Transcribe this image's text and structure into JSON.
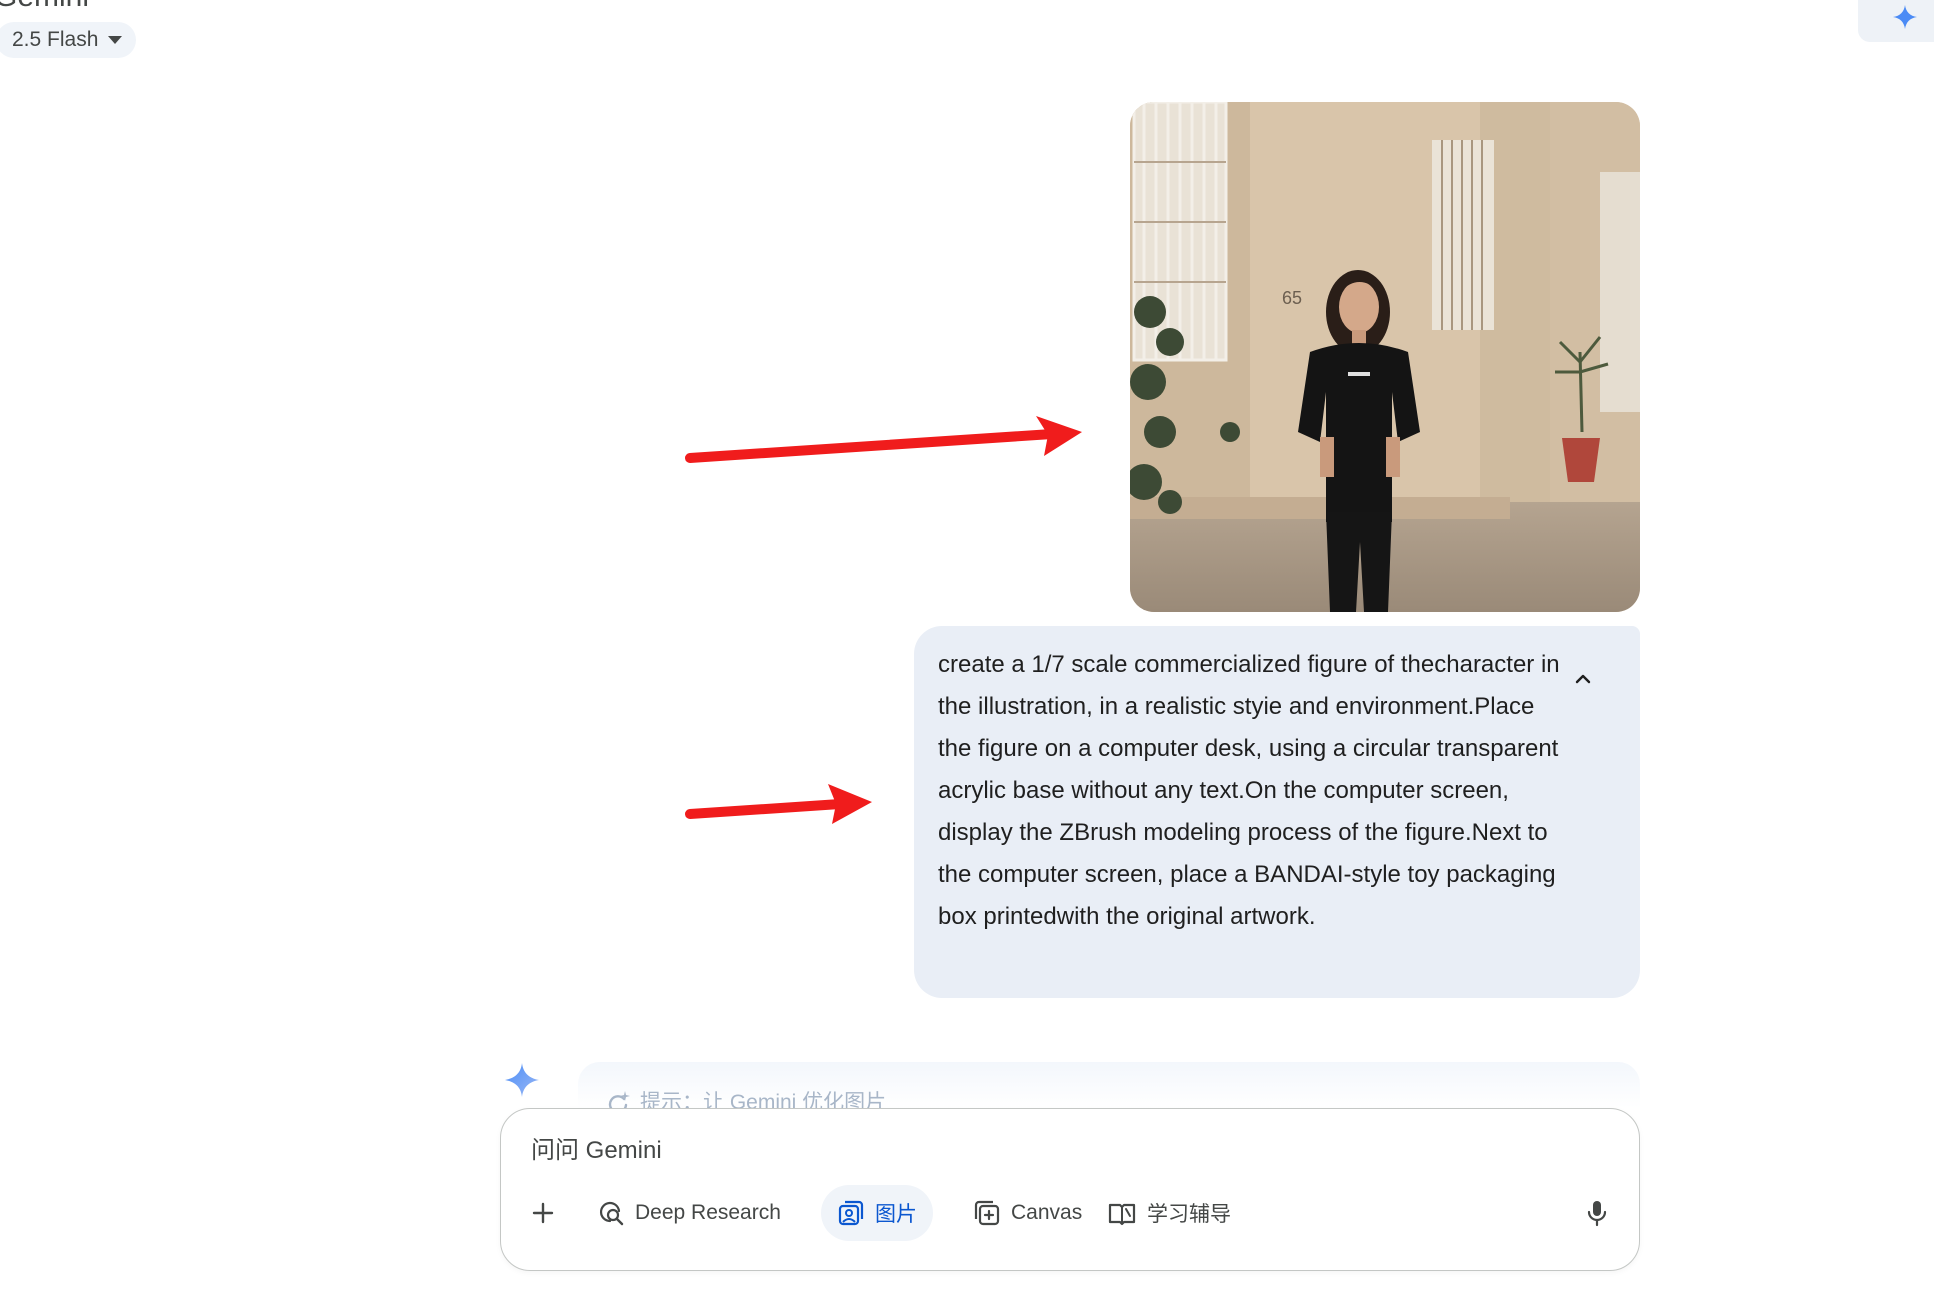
{
  "app": {
    "title": "Gemini"
  },
  "model_selector": {
    "label": "2.5 Flash"
  },
  "conversation": {
    "user_prompt": "create a 1/7 scale commercialized figure of thecharacter in the illustration, in a realistic styie and environment.Place the figure on a computer desk, using a circular transparent acrylic base without any text.On the computer screen, display the ZBrush modeling process of the figure.Next to the computer screen, place a BANDAI-style toy packaging box printedwith the original artwork.",
    "image_number_on_wall": "65"
  },
  "hint": {
    "text": "提示：让 Gemini 优化图片"
  },
  "composer": {
    "placeholder": "问问 Gemini",
    "tools": {
      "deep_research": "Deep Research",
      "image": "图片",
      "canvas": "Canvas",
      "guided_learning": "学习辅导"
    }
  },
  "colors": {
    "bubble": "#e9eef6",
    "accent": "#0b57d0",
    "annotation_arrow": "#f01c1c"
  },
  "icons": [
    "sparkle-icon",
    "chevron-up-icon",
    "plus-icon",
    "deep-research-icon",
    "image-icon",
    "canvas-icon",
    "book-icon",
    "mic-icon"
  ]
}
